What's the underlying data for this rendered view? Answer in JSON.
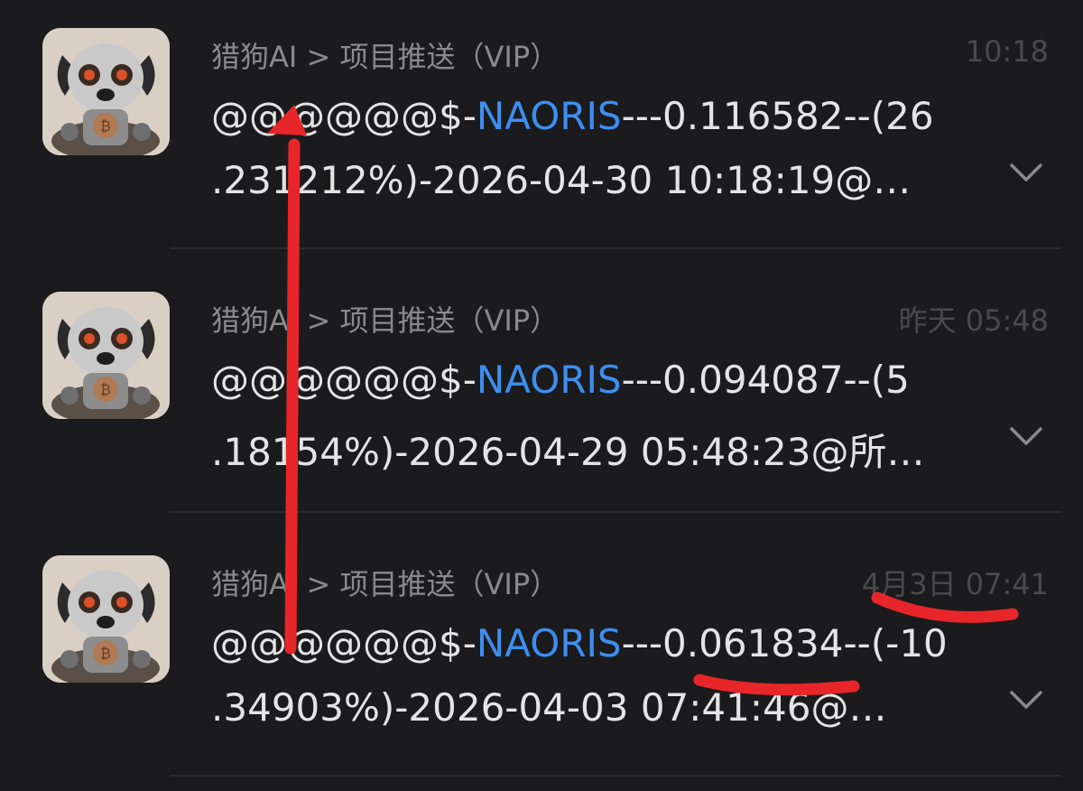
{
  "messages": [
    {
      "sender": "猎狗AI > 项目推送（VIP）",
      "time": "10:18",
      "line1_prefix": "@@@@@@$-",
      "ticker": "NAORIS",
      "line1_suffix": "---0.116582--(26",
      "line2": ".231212%)-2026-04-30 10:18:19@…"
    },
    {
      "sender": "猎狗AI > 项目推送（VIP）",
      "time": "昨天 05:48",
      "line1_prefix": "@@@@@@$-",
      "ticker": "NAORIS",
      "line1_suffix": "---0.094087--(5",
      "line2": ".18154%)-2026-04-29 05:48:23@所…"
    },
    {
      "sender": "猎狗AI > 项目推送（VIP）",
      "time": "4月3日 07:41",
      "line1_prefix": "@@@@@@$-",
      "ticker": "NAORIS",
      "line1_suffix": "---0.061834--(-10",
      "line2": ".34903%)-2026-04-03 07:41:46@…"
    }
  ],
  "icons": {
    "avatar": "robot-dog-bitcoin-avatar",
    "expand": "chevron-down-icon"
  },
  "colors": {
    "background": "#1b1b1d",
    "ticker": "#3d8ef0",
    "annotation": "#e8262a"
  }
}
